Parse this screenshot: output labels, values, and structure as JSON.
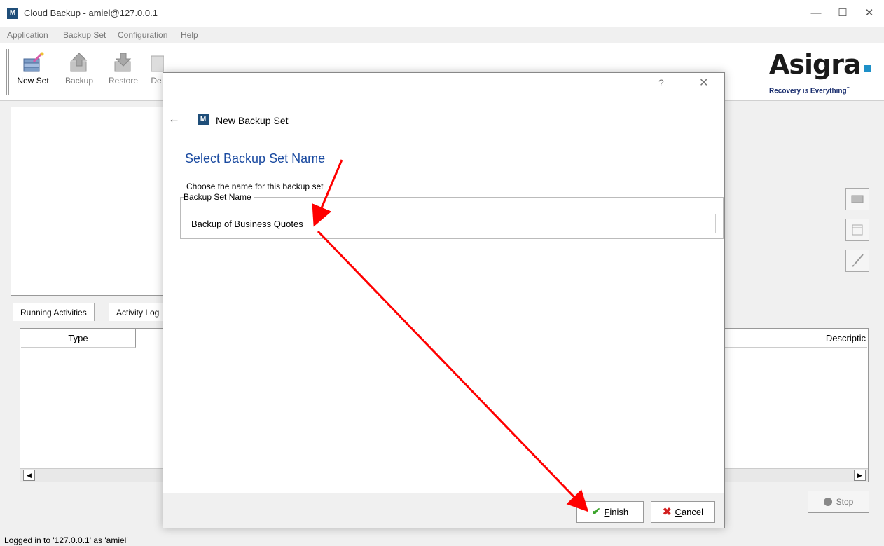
{
  "window": {
    "title": "Cloud Backup - amiel@127.0.0.1",
    "app_icon_letter": "M",
    "controls": {
      "minimize": "—",
      "maximize": "☐",
      "close": "✕"
    }
  },
  "menu": {
    "items": [
      "Application",
      "Backup Set",
      "Configuration",
      "Help"
    ]
  },
  "toolbar": {
    "buttons": [
      {
        "label": "New Set",
        "icon": "new-set-icon"
      },
      {
        "label": "Backup",
        "icon": "backup-icon"
      },
      {
        "label": "Restore",
        "icon": "restore-icon"
      },
      {
        "label": "De",
        "icon": "delete-icon"
      }
    ]
  },
  "logo": {
    "name": "Asigra",
    "tagline": "Recovery is Everything",
    "trademark": "™",
    "dot_color": "#1e90c8"
  },
  "tabs": [
    "Running Activities",
    "Activity Log"
  ],
  "table": {
    "columns": [
      "Type",
      "Descriptic"
    ]
  },
  "stop_button": {
    "label": "Stop"
  },
  "status": {
    "text": "Logged in to '127.0.0.1' as 'amiel'"
  },
  "dialog": {
    "help": "?",
    "close": "✕",
    "back": "←",
    "icon_letter": "M",
    "title": "New Backup Set",
    "heading": "Select Backup Set Name",
    "description": "Choose the name for this backup set",
    "group_label": "Backup Set Name",
    "name_value": "Backup of Business Quotes",
    "finish": {
      "prefix": "",
      "underline": "F",
      "rest": "inish"
    },
    "cancel": {
      "underline": "C",
      "rest": "ancel"
    }
  },
  "colors": {
    "heading": "#1a4aa0",
    "annotation_arrow": "#ff0000",
    "check": "#3aa32a",
    "cross": "#d21f1f"
  }
}
